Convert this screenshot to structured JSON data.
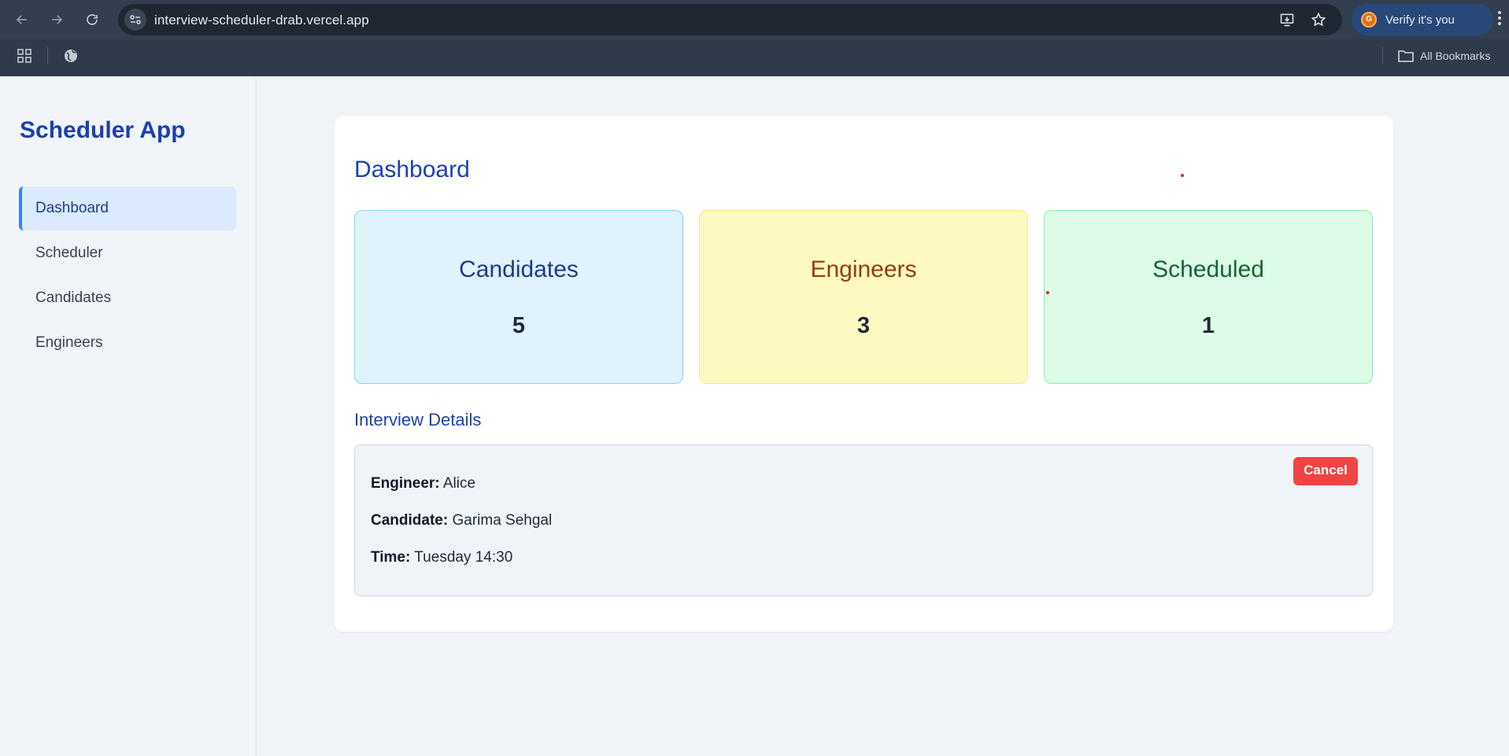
{
  "browser": {
    "url": "interview-scheduler-drab.vercel.app",
    "verify_label": "Verify it's you",
    "avatar_initial": "G",
    "bookmarks_label": "All Bookmarks"
  },
  "sidebar": {
    "app_title": "Scheduler App",
    "items": [
      {
        "label": "Dashboard",
        "active": true
      },
      {
        "label": "Scheduler"
      },
      {
        "label": "Candidates"
      },
      {
        "label": "Engineers"
      }
    ]
  },
  "dashboard": {
    "title": "Dashboard",
    "stats": [
      {
        "label": "Candidates",
        "value": "5"
      },
      {
        "label": "Engineers",
        "value": "3"
      },
      {
        "label": "Scheduled",
        "value": "1"
      }
    ],
    "section_title": "Interview Details",
    "interview": {
      "engineer_label": "Engineer:",
      "engineer": "Alice",
      "candidate_label": "Candidate:",
      "candidate": "Garima Sehgal",
      "time_label": "Time:",
      "time": "Tuesday 14:30",
      "cancel_label": "Cancel"
    }
  },
  "colors": {
    "brand": "#1e40af",
    "accent": "#3b82f6",
    "danger": "#ef4444"
  }
}
